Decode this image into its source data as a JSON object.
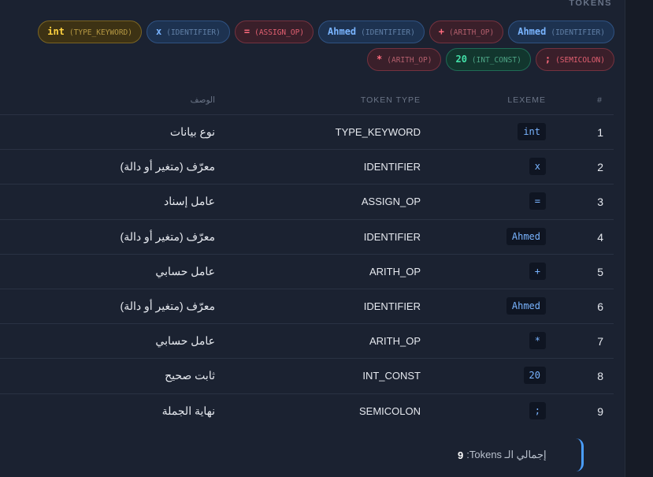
{
  "section_title": "TOKENS",
  "chips": [
    {
      "lexeme": "Ahmed",
      "type": "(IDENTIFIER)",
      "kind": "ident"
    },
    {
      "lexeme": "+",
      "type": "(ARITH_OP)",
      "kind": "arith"
    },
    {
      "lexeme": "Ahmed",
      "type": "(IDENTIFIER)",
      "kind": "ident"
    },
    {
      "lexeme": "=",
      "type": "(ASSIGN_OP)",
      "kind": "assign"
    },
    {
      "lexeme": "x",
      "type": "(IDENTIFIER)",
      "kind": "ident"
    },
    {
      "lexeme": "int",
      "type": "(TYPE_KEYWORD)",
      "kind": "kw"
    },
    {
      "lexeme": ";",
      "type": "(SEMICOLON)",
      "kind": "semi"
    },
    {
      "lexeme": "20",
      "type": "(INT_CONST)",
      "kind": "int"
    },
    {
      "lexeme": "*",
      "type": "(ARITH_OP)",
      "kind": "arith"
    }
  ],
  "table": {
    "headers": {
      "num": "#",
      "lexeme": "LEXEME",
      "type": "TOKEN TYPE",
      "desc": "الوصف"
    },
    "rows": [
      {
        "num": "1",
        "lexeme": "int",
        "type": "TYPE_KEYWORD",
        "desc": "نوع بيانات"
      },
      {
        "num": "2",
        "lexeme": "x",
        "type": "IDENTIFIER",
        "desc": "معرّف (متغير أو دالة)"
      },
      {
        "num": "3",
        "lexeme": "=",
        "type": "ASSIGN_OP",
        "desc": "عامل إسناد"
      },
      {
        "num": "4",
        "lexeme": "Ahmed",
        "type": "IDENTIFIER",
        "desc": "معرّف (متغير أو دالة)"
      },
      {
        "num": "5",
        "lexeme": "+",
        "type": "ARITH_OP",
        "desc": "عامل حسابي"
      },
      {
        "num": "6",
        "lexeme": "Ahmed",
        "type": "IDENTIFIER",
        "desc": "معرّف (متغير أو دالة)"
      },
      {
        "num": "7",
        "lexeme": "*",
        "type": "ARITH_OP",
        "desc": "عامل حسابي"
      },
      {
        "num": "8",
        "lexeme": "20",
        "type": "INT_CONST",
        "desc": "ثابت صحيح"
      },
      {
        "num": "9",
        "lexeme": ";",
        "type": "SEMICOLON",
        "desc": "نهاية الجملة"
      }
    ]
  },
  "total": {
    "label": "إجمالي الـ Tokens:",
    "count": "9"
  }
}
